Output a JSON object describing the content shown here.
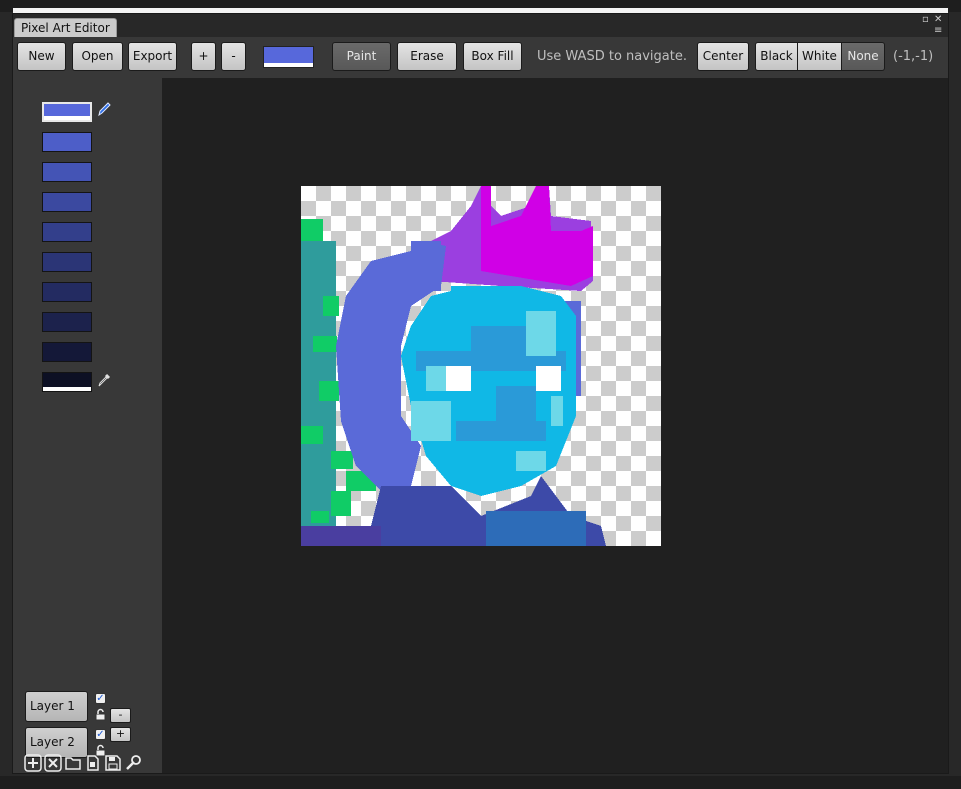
{
  "window": {
    "title": "Pixel Art Editor"
  },
  "toolbar": {
    "new_label": "New",
    "open_label": "Open",
    "export_label": "Export",
    "zoom_in_label": "+",
    "zoom_out_label": "-",
    "current_color": "#5768db",
    "paint_label": "Paint",
    "erase_label": "Erase",
    "box_fill_label": "Box Fill",
    "hint": "Use WASD to navigate.",
    "center_label": "Center",
    "bg_black_label": "Black",
    "bg_white_label": "White",
    "bg_none_label": "None",
    "active_tool": "Paint",
    "active_background": "None",
    "cursor_coords": "(-1,-1)"
  },
  "palette": {
    "colors": [
      "#5768db",
      "#4d5ec8",
      "#4454b5",
      "#3b49a0",
      "#333f8b",
      "#2b3576",
      "#232b61",
      "#1c224c",
      "#141838",
      "#0d1024"
    ],
    "selected_index": 0,
    "icons": [
      "pencil-icon",
      "eyedropper-icon"
    ]
  },
  "layers": [
    {
      "name": "Layer 1",
      "visible": true,
      "locked": false
    },
    {
      "name": "Layer 2",
      "visible": true,
      "locked": false
    }
  ],
  "layer_controls": {
    "remove_label": "-",
    "add_label": "+"
  },
  "bottom_tools": [
    "add-icon",
    "delete-icon",
    "new-file-icon",
    "open-file-icon",
    "save-icon",
    "settings-icon"
  ],
  "canvas": {
    "transparent_checker": [
      "#ffffff",
      "#cccccc"
    ],
    "art_colors": {
      "magenta": "#d000e6",
      "purple": "#9b3fe0",
      "blue": "#5a6ad8",
      "cyan": "#10b8e6",
      "mid_blue": "#2a9ad8",
      "light_cyan": "#6dd8e8",
      "white": "#ffffff",
      "teal": "#2f9c9c",
      "green": "#10cc66",
      "navy": "#3d4aa8",
      "indigo": "#4a3ea0",
      "steel": "#2d6cb8"
    }
  }
}
